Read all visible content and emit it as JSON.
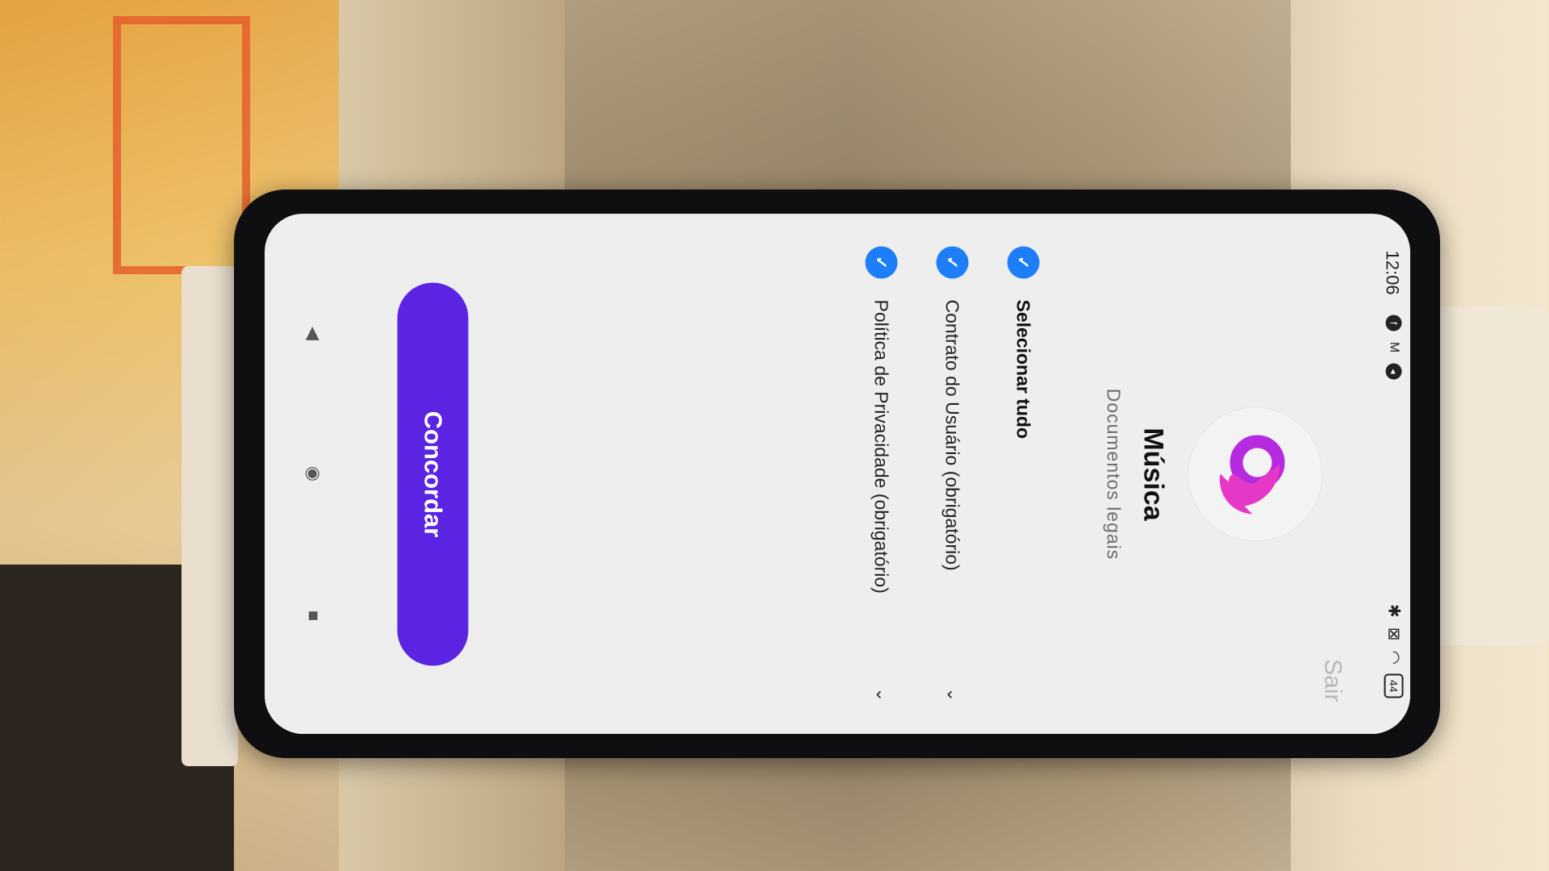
{
  "status_bar": {
    "time": "12:06",
    "left_icons": [
      "facebook-icon",
      "gmail-icon",
      "messenger-icon"
    ],
    "right_icons": [
      "bluetooth-icon",
      "no-sim-icon",
      "wifi-icon"
    ],
    "battery": "44"
  },
  "header": {
    "exit_label": "Sair"
  },
  "app": {
    "name": "Música",
    "subtitle": "Documentos legais",
    "logo_colors": [
      "#b62be0",
      "#e638c6"
    ]
  },
  "consents": {
    "select_all_label": "Selecionar tudo",
    "items": [
      {
        "label": "Contrato do Usuário (obrigatório)",
        "checked": true
      },
      {
        "label": "Política de Privacidade (obrigatório)",
        "checked": true
      }
    ]
  },
  "actions": {
    "agree_label": "Concordar",
    "agree_color": "#5a24e2"
  },
  "check_color": "#1e7ef7",
  "navigation": [
    "back-triangle-icon",
    "home-circle-icon",
    "recents-square-icon"
  ]
}
